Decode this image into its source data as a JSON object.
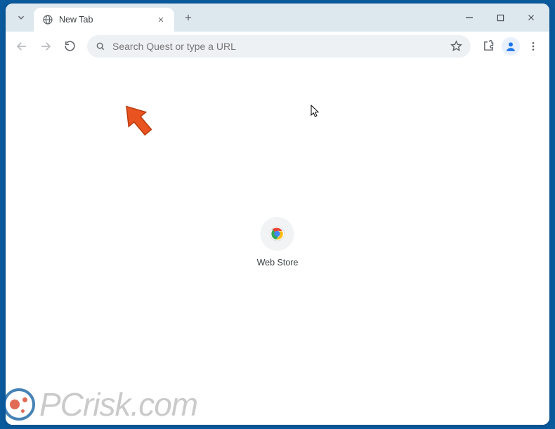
{
  "tab": {
    "title": "New Tab"
  },
  "omnibox": {
    "placeholder": "Search Quest or type a URL",
    "value": ""
  },
  "shortcut": {
    "label": "Web Store"
  },
  "watermark": {
    "text": "PCrisk.com"
  },
  "icons": {
    "chevron_down": "chevron-down-icon",
    "globe": "globe-icon",
    "close": "close-icon",
    "plus": "plus-icon",
    "minimize": "minimize-icon",
    "maximize": "maximize-icon",
    "win_close": "window-close-icon",
    "back": "back-icon",
    "forward": "forward-icon",
    "reload": "reload-icon",
    "search": "search-icon",
    "star": "star-icon",
    "extensions": "extensions-icon",
    "profile": "profile-icon",
    "menu": "menu-icon",
    "webstore": "chrome-webstore-icon"
  }
}
